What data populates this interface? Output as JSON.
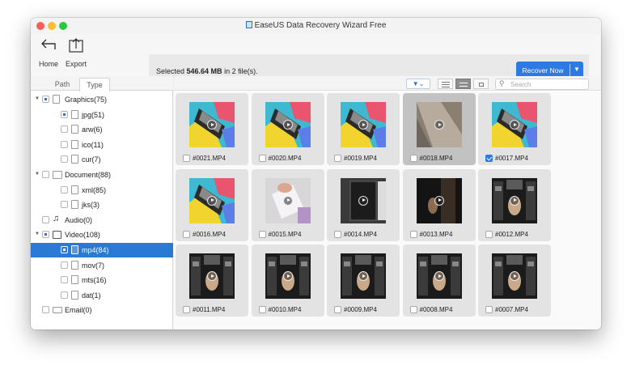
{
  "window": {
    "title": "EaseUS Data Recovery Wizard Free"
  },
  "toolbar": {
    "home_label": "Home",
    "export_label": "Export",
    "selection_prefix": "Selected ",
    "selection_size": "546.64 MB",
    "selection_suffix": " in 2 file(s).",
    "recover_label": "Recover Now"
  },
  "tabs": {
    "path": "Path",
    "type": "Type"
  },
  "search": {
    "placeholder": "Search"
  },
  "tree": [
    {
      "label": "Graphics(75)",
      "level": 0,
      "arrow": "down",
      "check": "partial",
      "icon": "file-icon"
    },
    {
      "label": "jpg(51)",
      "level": 1,
      "check": "partial",
      "icon": "jpg-file-icon"
    },
    {
      "label": "arw(6)",
      "level": 1,
      "check": "none",
      "icon": "arw-file-icon"
    },
    {
      "label": "ico(11)",
      "level": 1,
      "check": "none",
      "icon": "ico-file-icon"
    },
    {
      "label": "cur(7)",
      "level": 1,
      "check": "none",
      "icon": "cur-file-icon"
    },
    {
      "label": "Document(88)",
      "level": 0,
      "arrow": "down",
      "check": "none",
      "icon": "document-icon"
    },
    {
      "label": "xml(85)",
      "level": 1,
      "check": "none",
      "icon": "xml-file-icon"
    },
    {
      "label": "jks(3)",
      "level": 1,
      "check": "none",
      "icon": "jks-file-icon"
    },
    {
      "label": "Audio(0)",
      "level": 0,
      "check": "none",
      "icon": "audio-note-icon"
    },
    {
      "label": "Video(108)",
      "level": 0,
      "arrow": "down",
      "check": "partial",
      "icon": "film-icon"
    },
    {
      "label": "mp4(84)",
      "level": 1,
      "check": "partial",
      "icon": "mp4-file-icon",
      "selected": true
    },
    {
      "label": "mov(7)",
      "level": 1,
      "check": "none",
      "icon": "mov-file-icon"
    },
    {
      "label": "mts(16)",
      "level": 1,
      "check": "none",
      "icon": "mts-file-icon"
    },
    {
      "label": "dat(1)",
      "level": 1,
      "check": "none",
      "icon": "dat-file-icon"
    },
    {
      "label": "Email(0)",
      "level": 0,
      "check": "none",
      "icon": "mail-icon"
    }
  ],
  "files": [
    {
      "name": "#0021.MP4",
      "checked": false,
      "style": "colorful"
    },
    {
      "name": "#0020.MP4",
      "checked": false,
      "style": "colorful"
    },
    {
      "name": "#0019.MP4",
      "checked": false,
      "style": "colorful"
    },
    {
      "name": "#0018.MP4",
      "checked": false,
      "style": "blur",
      "highlighted": true
    },
    {
      "name": "#0017.MP4",
      "checked": true,
      "style": "colorful"
    },
    {
      "name": "#0016.MP4",
      "checked": false,
      "style": "colorful"
    },
    {
      "name": "#0015.MP4",
      "checked": false,
      "style": "hand"
    },
    {
      "name": "#0014.MP4",
      "checked": false,
      "style": "speaker"
    },
    {
      "name": "#0013.MP4",
      "checked": false,
      "style": "dark"
    },
    {
      "name": "#0012.MP4",
      "checked": false,
      "style": "studio"
    },
    {
      "name": "#0011.MP4",
      "checked": false,
      "style": "studio"
    },
    {
      "name": "#0010.MP4",
      "checked": false,
      "style": "studio"
    },
    {
      "name": "#0009.MP4",
      "checked": false,
      "style": "studio"
    },
    {
      "name": "#0008.MP4",
      "checked": false,
      "style": "studio"
    },
    {
      "name": "#0007.MP4",
      "checked": false,
      "style": "studio"
    }
  ]
}
